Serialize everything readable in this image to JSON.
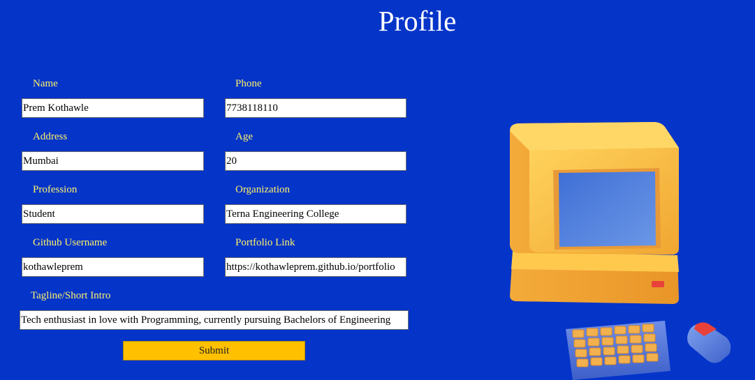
{
  "page": {
    "title": "Profile"
  },
  "form": {
    "fields": {
      "name": {
        "label": "Name",
        "value": "Prem Kothawle"
      },
      "phone": {
        "label": "Phone",
        "value": "7738118110"
      },
      "address": {
        "label": "Address",
        "value": "Mumbai"
      },
      "age": {
        "label": "Age",
        "value": "20"
      },
      "profession": {
        "label": "Profession",
        "value": "Student"
      },
      "organization": {
        "label": "Organization",
        "value": "Terna Engineering College"
      },
      "github": {
        "label": "Github Username",
        "value": "kothawleprem"
      },
      "portfolio": {
        "label": "Portfolio Link",
        "value": "https://kothawleprem.github.io/portfolio"
      },
      "tagline": {
        "label": "Tagline/Short Intro",
        "value": "Tech enthusiast in love with Programming, currently pursuing Bachelors of Engineering"
      }
    },
    "submit_label": "Submit"
  },
  "illustration": {
    "icon": "retro-computer-illustration"
  },
  "colors": {
    "background": "#0534c9",
    "label": "#fff36a",
    "title": "#ffffff",
    "submit_button": "#ffc000",
    "computer_body": "#f5b83c",
    "computer_screen": "#4a7ddb"
  }
}
